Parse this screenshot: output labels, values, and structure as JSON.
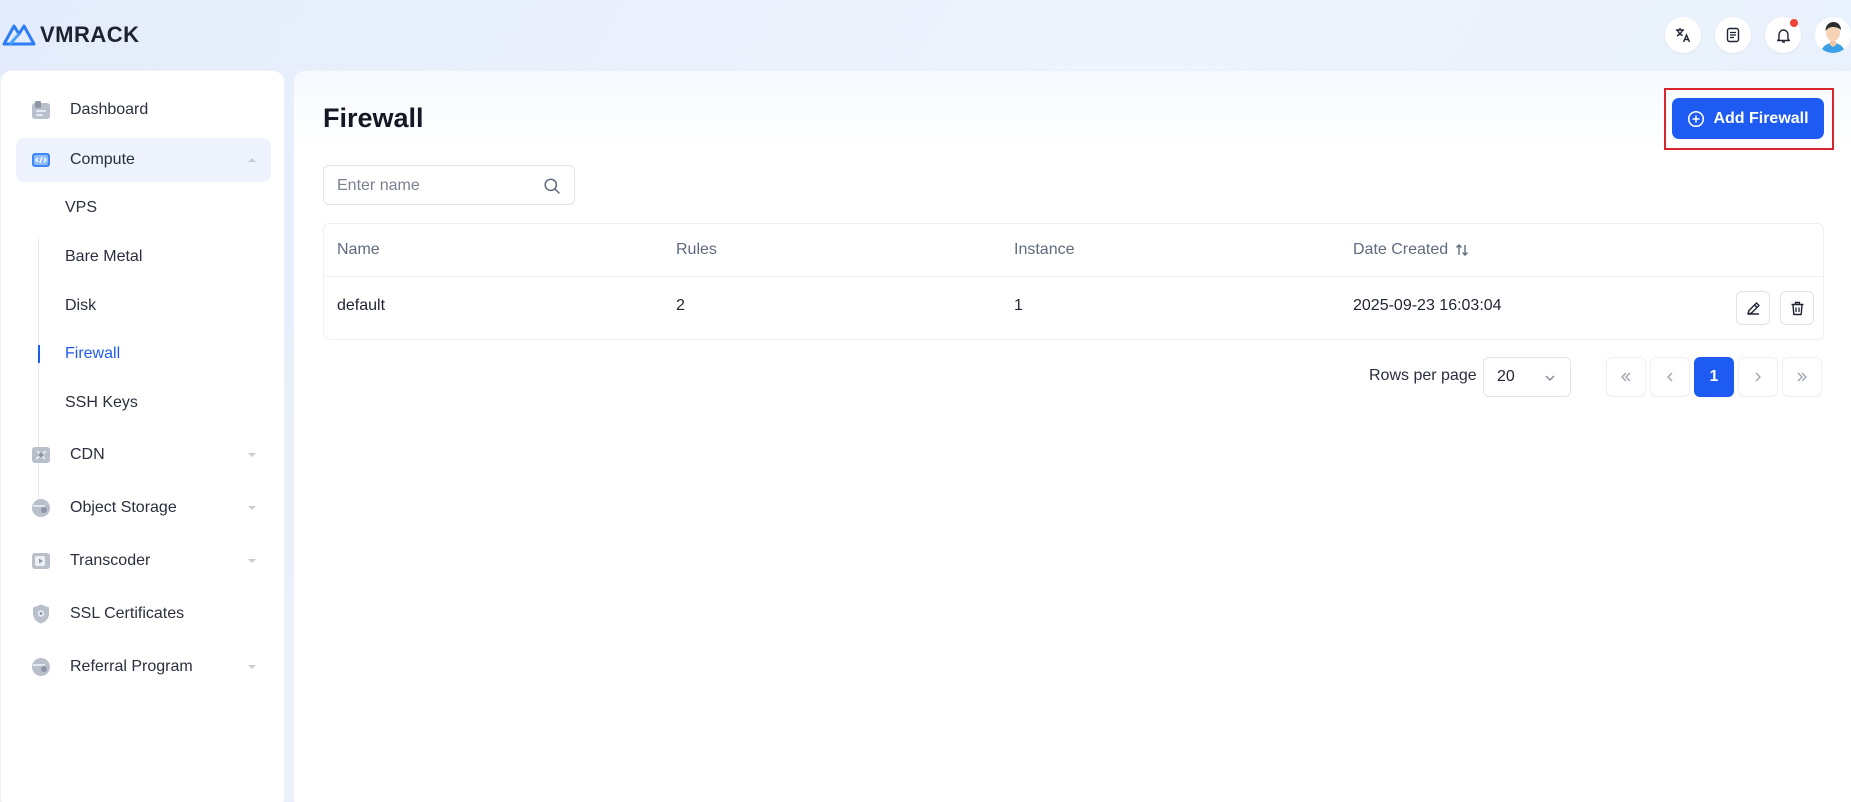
{
  "app": {
    "brand": "VMRACK"
  },
  "sidebar": {
    "items": [
      {
        "label": "Dashboard",
        "icon": "dashboard-icon"
      },
      {
        "label": "Compute",
        "icon": "compute-icon",
        "expanded": true
      },
      {
        "label": "CDN",
        "icon": "cdn-icon"
      },
      {
        "label": "Object Storage",
        "icon": "object-storage-icon"
      },
      {
        "label": "Transcoder",
        "icon": "transcoder-icon"
      },
      {
        "label": "SSL Certificates",
        "icon": "ssl-certificate-icon"
      },
      {
        "label": "Referral Program",
        "icon": "referral-icon"
      }
    ],
    "compute_sub": [
      "VPS",
      "Bare Metal",
      "Disk",
      "Firewall",
      "SSH Keys"
    ],
    "active_sub": "Firewall"
  },
  "page": {
    "title": "Firewall",
    "add_button": "Add Firewall",
    "search_placeholder": "Enter name"
  },
  "table": {
    "headers": [
      "Name",
      "Rules",
      "Instance",
      "Date Created"
    ],
    "rows": [
      {
        "name": "default",
        "rules": "2",
        "instance": "1",
        "date": "2025-09-23 16:03:04"
      }
    ]
  },
  "pagination": {
    "rows_label": "Rows per page",
    "rows_value": "20",
    "current_page": "1"
  },
  "colors": {
    "accent": "#1d5bf2",
    "highlight": "#d9262c",
    "badge": "#f04438"
  }
}
